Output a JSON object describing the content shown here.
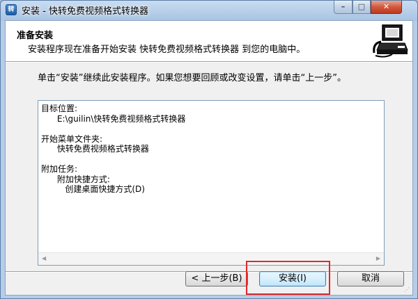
{
  "window": {
    "title": "安装 - 快转免费视频格式转换器",
    "app_icon_text": "转",
    "controls": {
      "minimize": "–",
      "maximize": "□",
      "close": "✕"
    }
  },
  "header": {
    "title": "准备安装",
    "subtitle": "安装程序现在准备开始安装 快转免费视频格式转换器 到您的电脑中。",
    "image_icon": "computer-install-icon"
  },
  "intro_text": "单击“安装”继续此安装程序。如果您想要回顾或改变设置，请单击“上一步”。",
  "summary": {
    "text": "目标位置:\n      E:\\guilin\\快转免费视频格式转换器\n\n开始菜单文件夹:\n      快转免费视频格式转换器\n\n附加任务:\n      附加快捷方式:\n         创建桌面快捷方式(D)"
  },
  "scrollbar": {
    "left_arrow": "◀",
    "right_arrow": "▶"
  },
  "buttons": {
    "back": "< 上一步(B)",
    "install": "安装(I)",
    "cancel": "取消"
  },
  "highlight_color": "#e0282a"
}
